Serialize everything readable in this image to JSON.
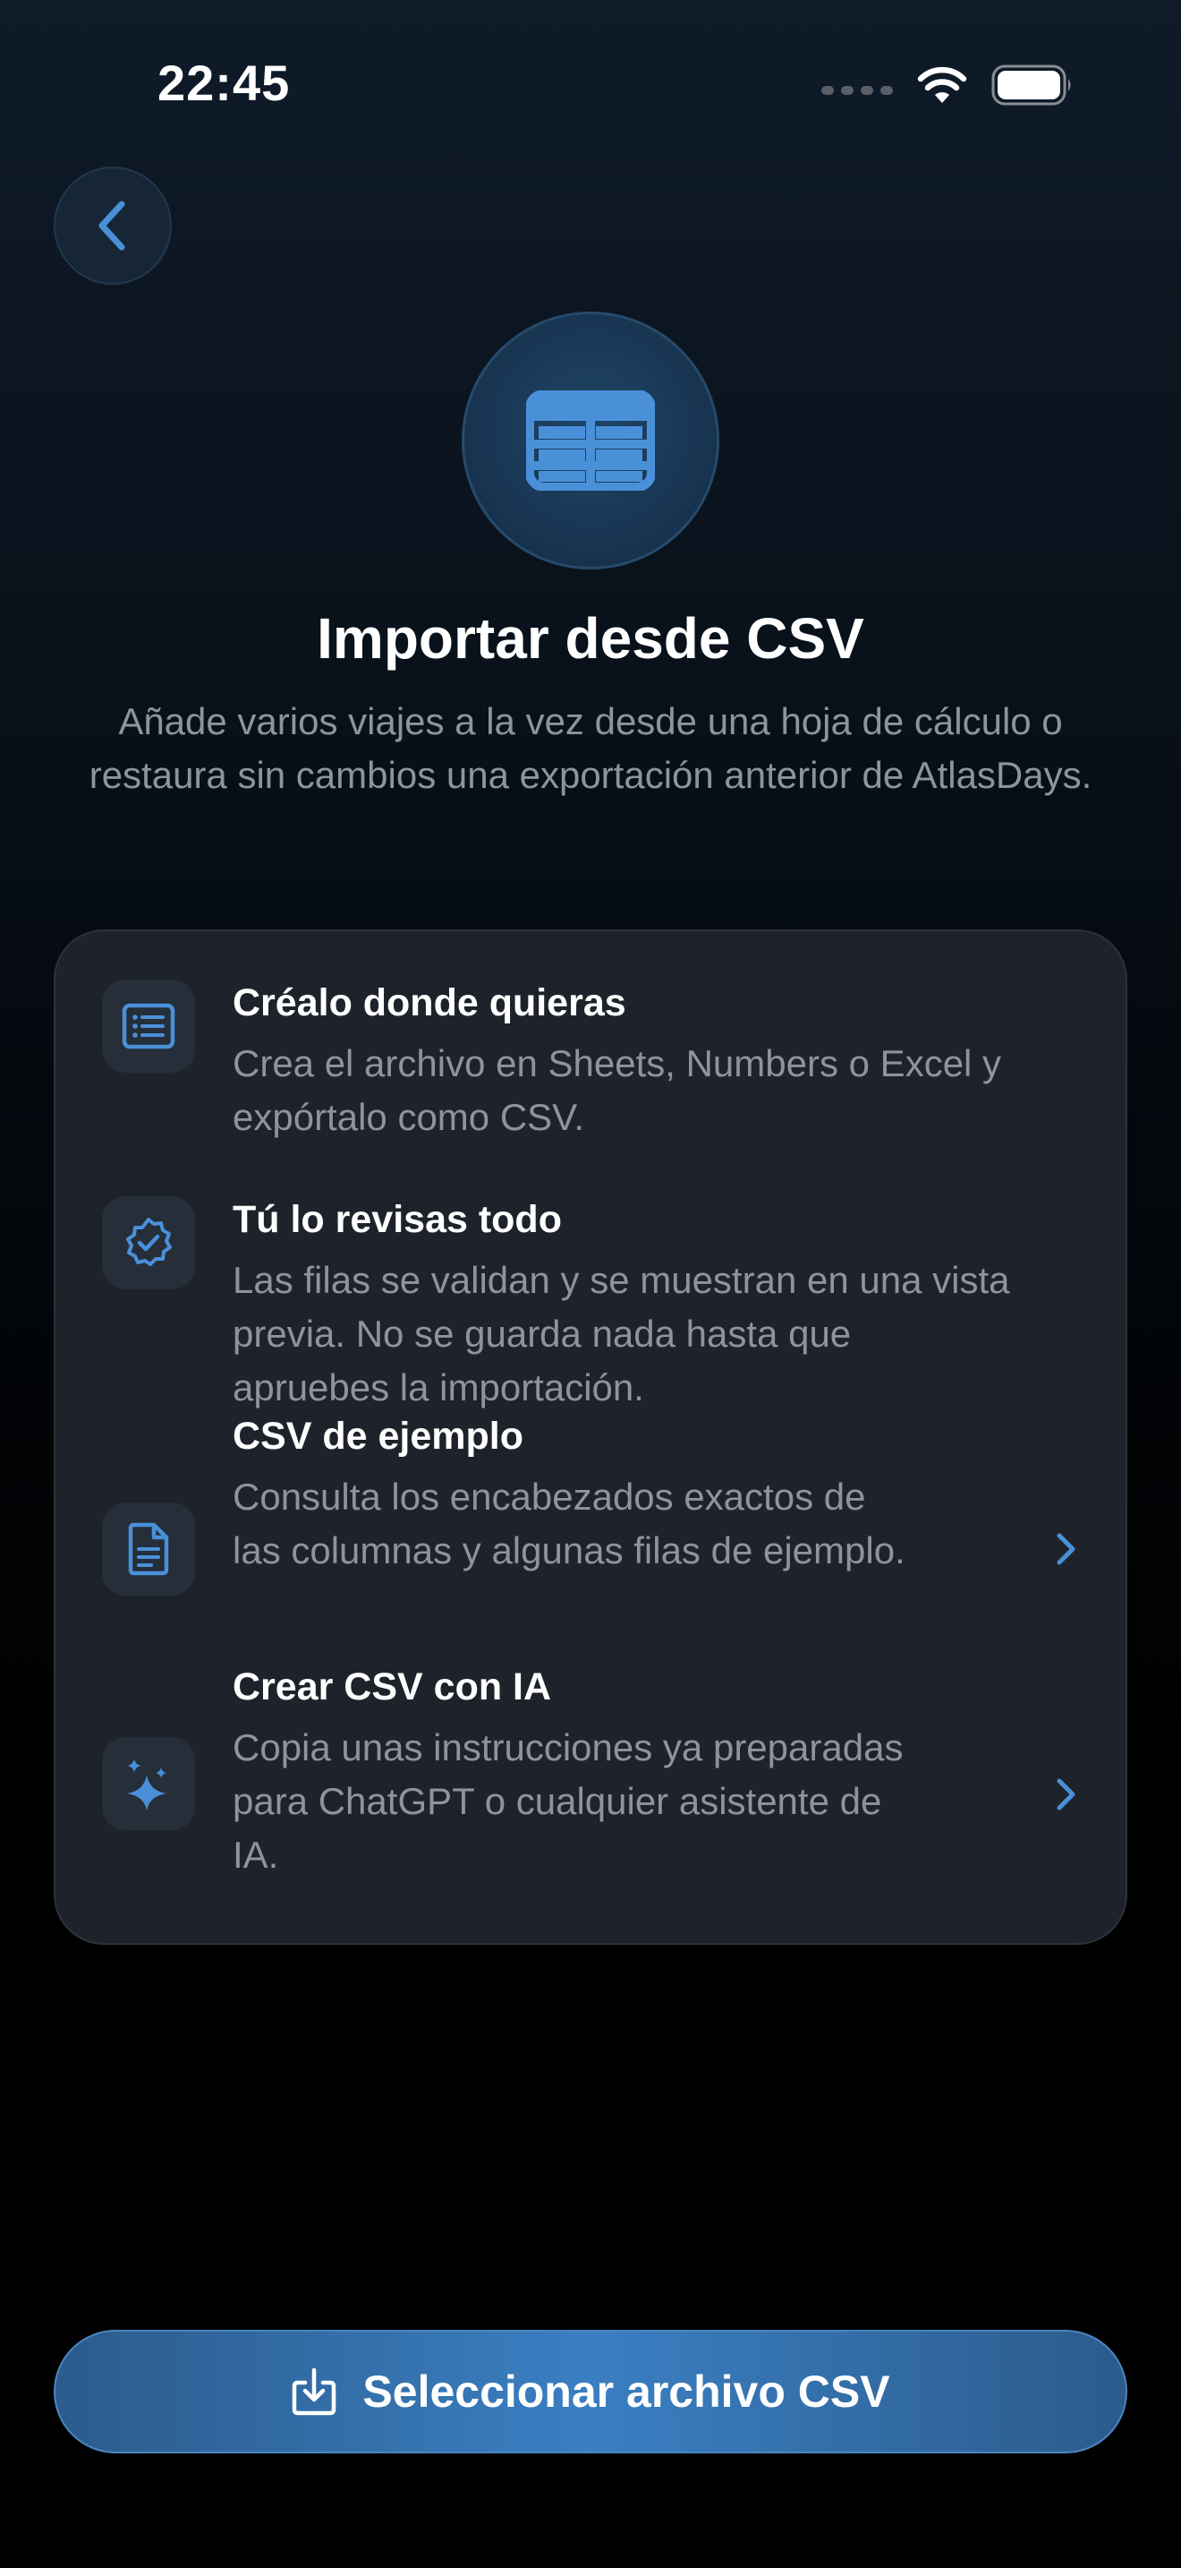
{
  "status_bar": {
    "time": "22:45"
  },
  "header": {
    "title": "Importar desde CSV",
    "subtitle": "Añade varios viajes a la vez desde una hoja de cálculo o restaura sin cambios una exportación anterior de AtlasDays."
  },
  "card": {
    "items": [
      {
        "title": "Créalo donde quieras",
        "desc_lines": [
          "Crea el archivo en Sheets, Numbers o Excel y",
          "expórtalo como CSV."
        ],
        "icon": "list-icon",
        "has_chevron": false
      },
      {
        "title": "Tú lo revisas todo",
        "desc_lines": [
          "Las filas se validan y se muestran en una vista",
          "previa. No se guarda nada hasta que",
          "apruebes la importación."
        ],
        "icon": "verified-badge-icon",
        "has_chevron": false
      },
      {
        "title": "CSV de ejemplo",
        "desc_lines": [
          "Consulta los encabezados exactos de",
          "las columnas y algunas filas de ejemplo."
        ],
        "icon": "document-icon",
        "has_chevron": true
      },
      {
        "title": "Crear CSV con IA",
        "desc_lines": [
          "Copia unas instrucciones ya preparadas",
          "para ChatGPT o cualquier asistente de",
          "IA."
        ],
        "icon": "sparkles-icon",
        "has_chevron": true
      }
    ]
  },
  "cta": {
    "label": "Seleccionar archivo CSV",
    "icon": "download-tray-icon"
  },
  "colors": {
    "accent": "#4a90d9",
    "card_bg": "#1e232b",
    "secondary_text": "#8e949c"
  }
}
